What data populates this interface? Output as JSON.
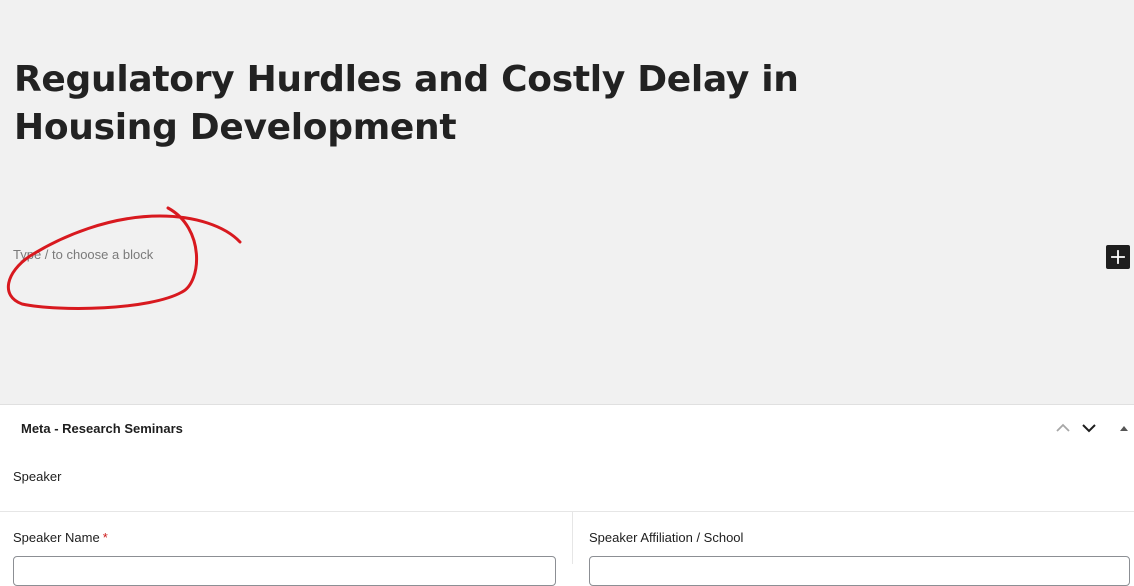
{
  "post": {
    "title": "Regulatory Hurdles and Costly Delay in Housing Development",
    "block_placeholder": "Type / to choose a block"
  },
  "toolbar": {
    "add_block_icon": "plus-icon"
  },
  "annotation": {
    "color": "#d8191f",
    "shape": "hand-drawn circle"
  },
  "meta_box": {
    "title": "Meta - Research Seminars",
    "controls": {
      "move_up_icon": "chevron-up-icon",
      "move_down_icon": "chevron-down-icon",
      "toggle_icon": "caret-up-icon"
    },
    "section_label": "Speaker",
    "fields": [
      {
        "label": "Speaker Name",
        "required": true,
        "required_marker": "*",
        "value": ""
      },
      {
        "label": "Speaker Affiliation / School",
        "required": false,
        "value": ""
      }
    ]
  }
}
